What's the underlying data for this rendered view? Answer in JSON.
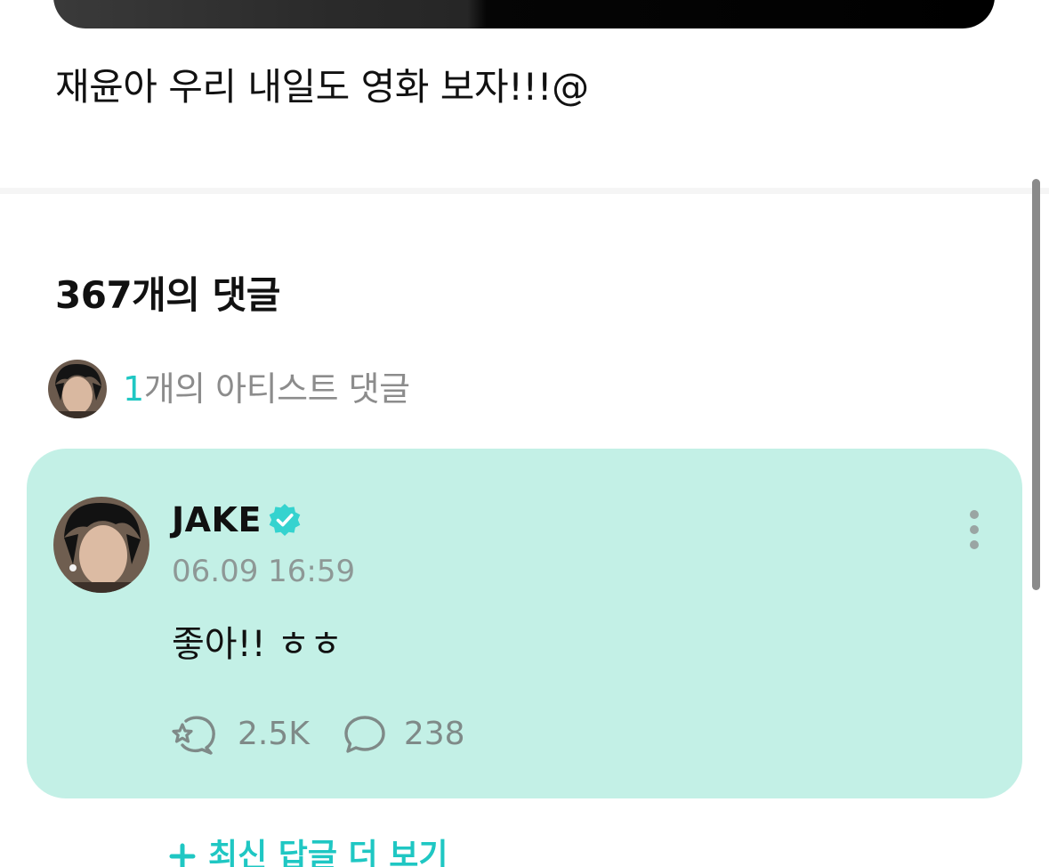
{
  "post": {
    "text": "재윤아 우리 내일도 영화 보자!!!@"
  },
  "comments": {
    "count_label": "367개의 댓글",
    "artist_summary": {
      "count": "1",
      "suffix": "개의 아티스트 댓글",
      "avatar_icon": "artist-avatar"
    }
  },
  "artist_comment": {
    "author": "JAKE",
    "verified_icon": "verified-badge-icon",
    "timestamp": "06.09 16:59",
    "body": "좋아!! ㅎㅎ",
    "likes": "2.5K",
    "replies": "238",
    "like_icon": "cheer-like-icon",
    "reply_icon": "comment-bubble-icon",
    "more_icon": "vertical-dots-icon"
  },
  "more_replies": {
    "label": "최신 답글 더 보기",
    "icon": "plus-icon"
  },
  "colors": {
    "accent": "#1fc7c3",
    "card_background": "#c3f0e6",
    "muted_text": "#8c8c8c",
    "divider": "#f5f5f5"
  }
}
